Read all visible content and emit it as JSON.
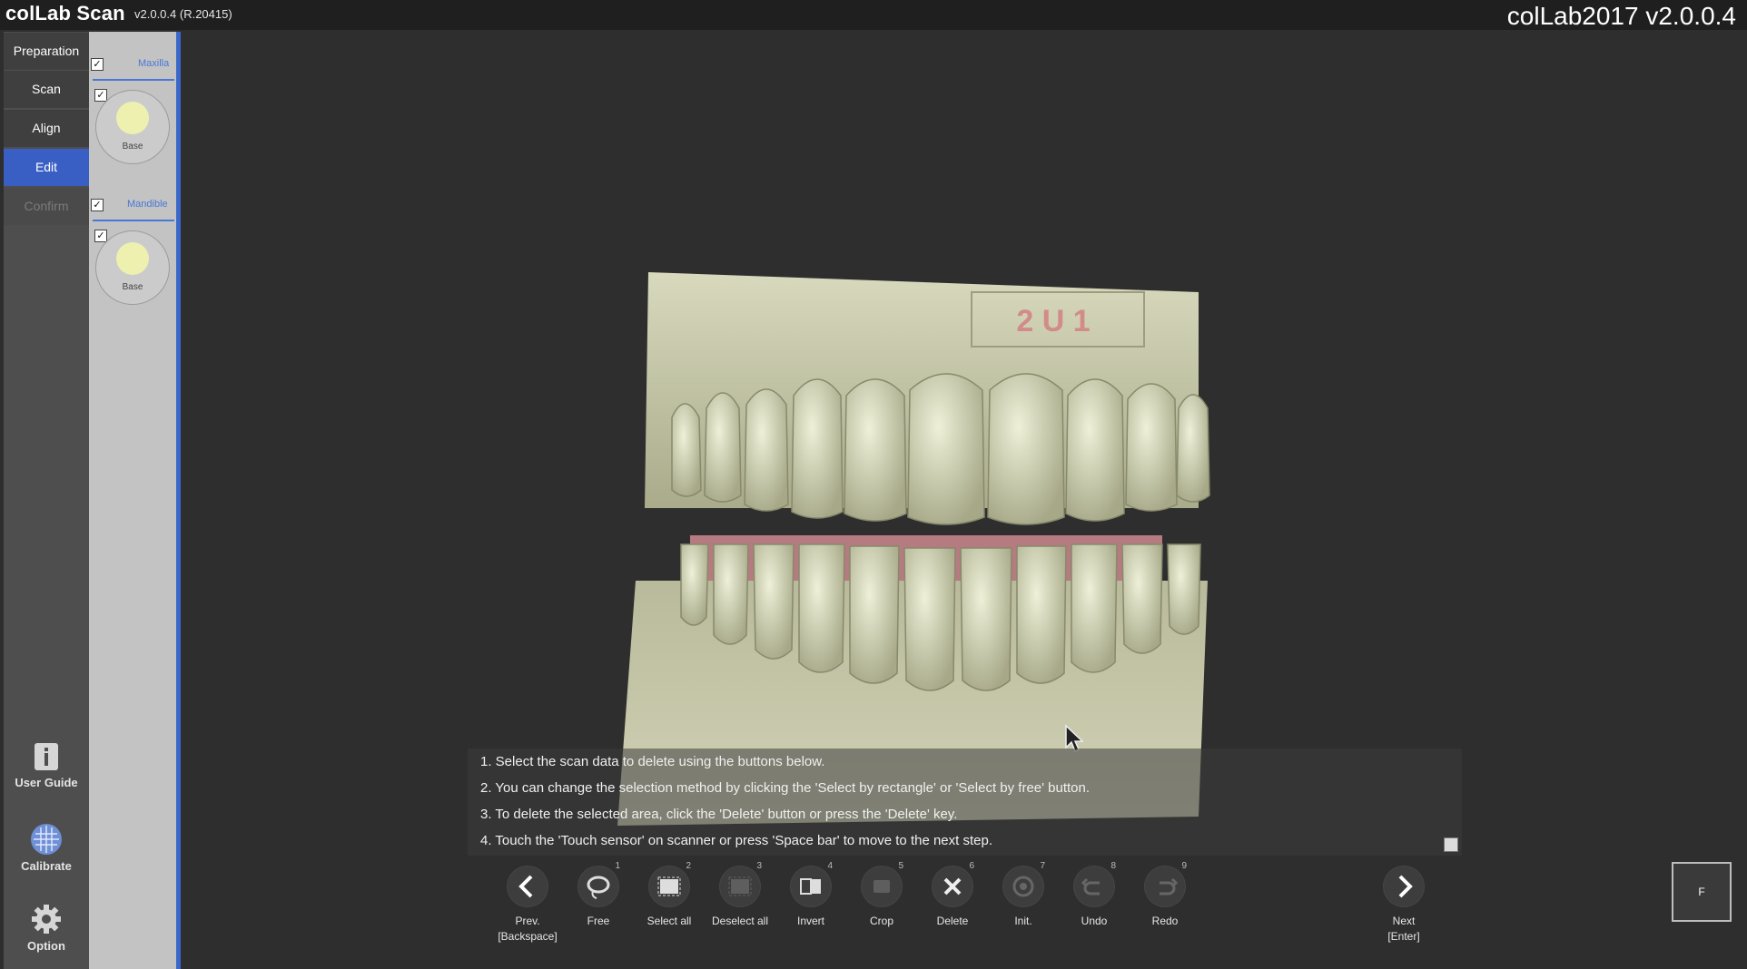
{
  "titlebar": {
    "app_name": "colLab Scan",
    "version": "v2.0.0.4 (R.20415)",
    "window_title": "colLab2017 v2.0.0.4"
  },
  "steps": [
    {
      "label": "Preparation",
      "state": "normal"
    },
    {
      "label": "Scan",
      "state": "normal"
    },
    {
      "label": "Align",
      "state": "normal"
    },
    {
      "label": "Edit",
      "state": "active"
    },
    {
      "label": "Confirm",
      "state": "disabled"
    }
  ],
  "side_tools": {
    "user_guide": "User Guide",
    "calibrate": "Calibrate",
    "option": "Option"
  },
  "tree": {
    "maxilla": {
      "label": "Maxilla",
      "checked": true,
      "node_label": "Base"
    },
    "mandible": {
      "label": "Mandible",
      "checked": true,
      "node_label": "Base"
    }
  },
  "instructions": [
    "1. Select the scan data to delete using the buttons below.",
    "2. You can change the selection method by clicking the 'Select by rectangle' or 'Select by free' button.",
    "3. To delete the selected area, click the 'Delete' button or press the 'Delete' key.",
    "4. Touch the 'Touch sensor' on scanner or press 'Space bar' to move to the next step."
  ],
  "toolbar": {
    "prev": {
      "label": "Prev.",
      "key": "[Backspace]"
    },
    "free": {
      "label": "Free",
      "shortcut": "1"
    },
    "select_all": {
      "label": "Select all",
      "shortcut": "2"
    },
    "deselect_all": {
      "label": "Deselect all",
      "shortcut": "3"
    },
    "invert": {
      "label": "Invert",
      "shortcut": "4"
    },
    "crop": {
      "label": "Crop",
      "shortcut": "5"
    },
    "delete": {
      "label": "Delete",
      "shortcut": "6"
    },
    "init": {
      "label": "Init.",
      "shortcut": "7"
    },
    "undo": {
      "label": "Undo",
      "shortcut": "8"
    },
    "redo": {
      "label": "Redo",
      "shortcut": "9"
    },
    "next": {
      "label": "Next",
      "key": "[Enter]"
    }
  },
  "view_button": "F",
  "colors": {
    "accent": "#3a5fc4",
    "model": "#c9caa6",
    "gum": "#c97a86"
  }
}
